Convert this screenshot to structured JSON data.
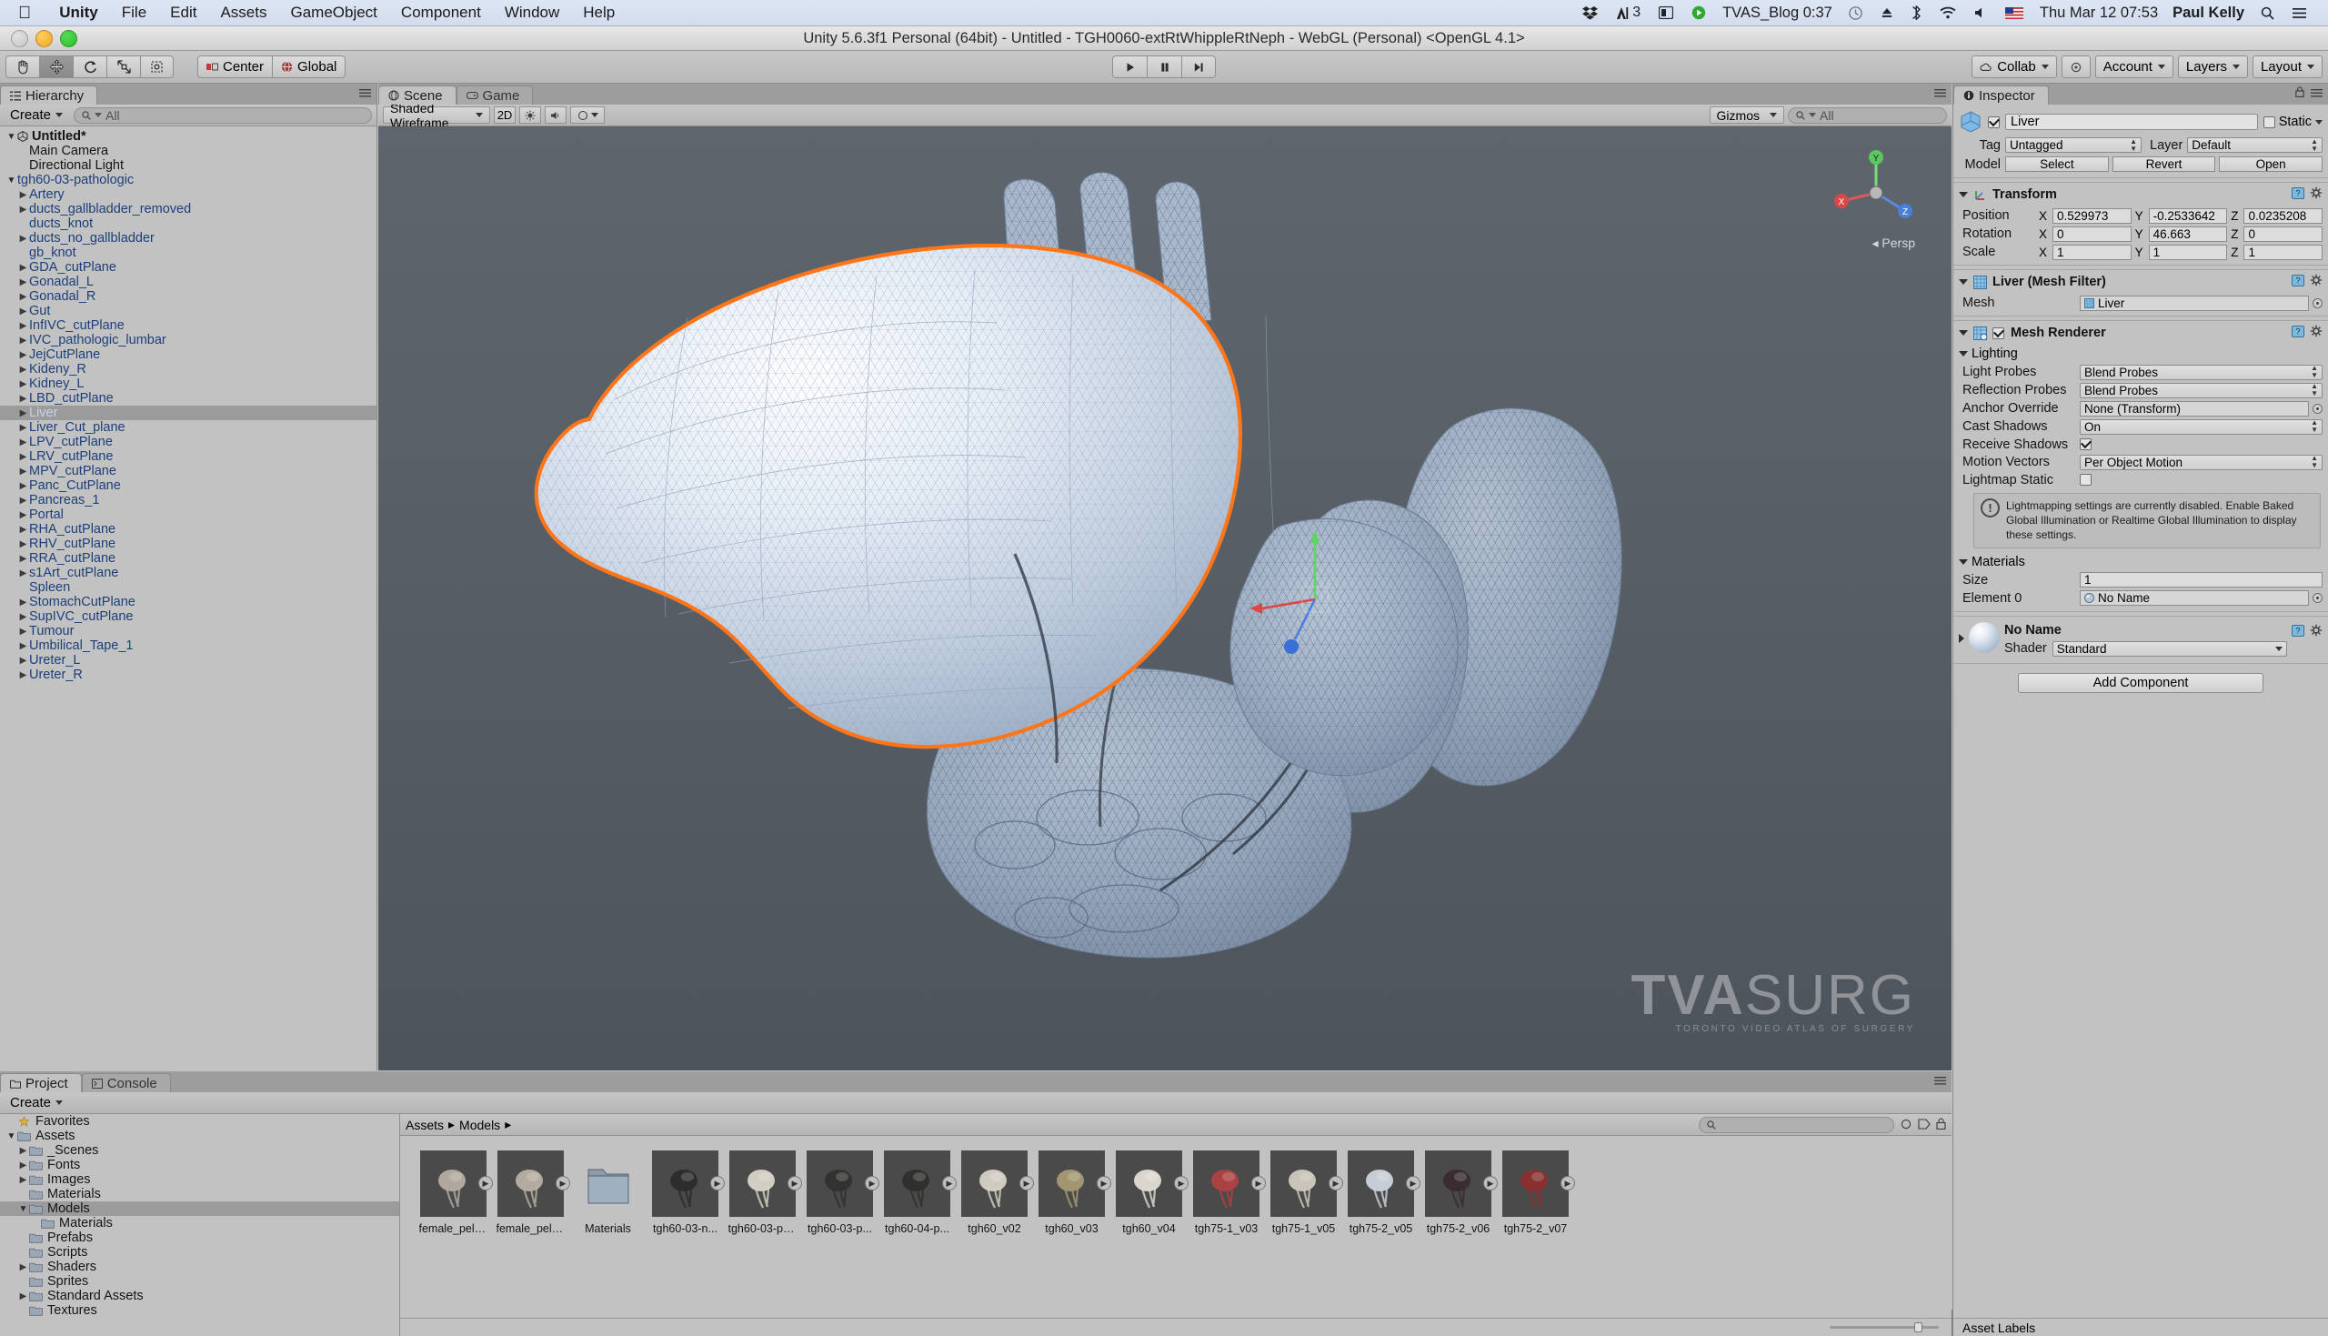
{
  "mac_menu": {
    "apple": "apple-logo",
    "items": [
      "Unity",
      "File",
      "Edit",
      "Assets",
      "GameObject",
      "Component",
      "Window",
      "Help"
    ],
    "status": {
      "adobe_count": "3",
      "recorder_label": "TVAS_Blog 0:37",
      "datetime": "Thu Mar 12  07:53",
      "user": "Paul Kelly"
    }
  },
  "window": {
    "title": "Unity 5.6.3f1 Personal (64bit) - Untitled - TGH0060-extRtWhippleRtNeph - WebGL (Personal) <OpenGL 4.1>"
  },
  "toolbar": {
    "tools": [
      "hand-tool",
      "move-tool",
      "rotate-tool",
      "scale-tool",
      "rect-tool"
    ],
    "active_tool": "move-tool",
    "pivot": "Center",
    "space": "Global",
    "play": "play-button",
    "pause": "pause-button",
    "step": "step-button",
    "collab": "Collab",
    "account": "Account",
    "layers": "Layers",
    "layout": "Layout"
  },
  "hierarchy": {
    "tab": "Hierarchy",
    "create": "Create",
    "search_placeholder": "All",
    "root": "Untitled*",
    "items": [
      {
        "label": "Main Camera",
        "indent": 1,
        "arrow": false,
        "prefab": false
      },
      {
        "label": "Directional Light",
        "indent": 1,
        "arrow": false,
        "prefab": false
      },
      {
        "label": "tgh60-03-pathologic",
        "indent": 0,
        "arrow": true,
        "open": true,
        "prefab": true
      },
      {
        "label": "Artery",
        "indent": 1,
        "arrow": true,
        "prefab": true
      },
      {
        "label": "ducts_gallbladder_removed",
        "indent": 1,
        "arrow": true,
        "prefab": true
      },
      {
        "label": "ducts_knot",
        "indent": 1,
        "arrow": false,
        "prefab": true
      },
      {
        "label": "ducts_no_gallbladder",
        "indent": 1,
        "arrow": true,
        "prefab": true
      },
      {
        "label": "gb_knot",
        "indent": 1,
        "arrow": false,
        "prefab": true
      },
      {
        "label": "GDA_cutPlane",
        "indent": 1,
        "arrow": true,
        "prefab": true
      },
      {
        "label": "Gonadal_L",
        "indent": 1,
        "arrow": true,
        "prefab": true
      },
      {
        "label": "Gonadal_R",
        "indent": 1,
        "arrow": true,
        "prefab": true
      },
      {
        "label": "Gut",
        "indent": 1,
        "arrow": true,
        "prefab": true
      },
      {
        "label": "InfIVC_cutPlane",
        "indent": 1,
        "arrow": true,
        "prefab": true
      },
      {
        "label": "IVC_pathologic_lumbar",
        "indent": 1,
        "arrow": true,
        "prefab": true
      },
      {
        "label": "JejCutPlane",
        "indent": 1,
        "arrow": true,
        "prefab": true
      },
      {
        "label": "Kideny_R",
        "indent": 1,
        "arrow": true,
        "prefab": true
      },
      {
        "label": "Kidney_L",
        "indent": 1,
        "arrow": true,
        "prefab": true
      },
      {
        "label": "LBD_cutPlane",
        "indent": 1,
        "arrow": true,
        "prefab": true
      },
      {
        "label": "Liver",
        "indent": 1,
        "arrow": true,
        "prefab": true,
        "selected": true
      },
      {
        "label": "Liver_Cut_plane",
        "indent": 1,
        "arrow": true,
        "prefab": true
      },
      {
        "label": "LPV_cutPlane",
        "indent": 1,
        "arrow": true,
        "prefab": true
      },
      {
        "label": "LRV_cutPlane",
        "indent": 1,
        "arrow": true,
        "prefab": true
      },
      {
        "label": "MPV_cutPlane",
        "indent": 1,
        "arrow": true,
        "prefab": true
      },
      {
        "label": "Panc_CutPlane",
        "indent": 1,
        "arrow": true,
        "prefab": true
      },
      {
        "label": "Pancreas_1",
        "indent": 1,
        "arrow": true,
        "prefab": true
      },
      {
        "label": "Portal",
        "indent": 1,
        "arrow": true,
        "prefab": true
      },
      {
        "label": "RHA_cutPlane",
        "indent": 1,
        "arrow": true,
        "prefab": true
      },
      {
        "label": "RHV_cutPlane",
        "indent": 1,
        "arrow": true,
        "prefab": true
      },
      {
        "label": "RRA_cutPlane",
        "indent": 1,
        "arrow": true,
        "prefab": true
      },
      {
        "label": "s1Art_cutPlane",
        "indent": 1,
        "arrow": true,
        "prefab": true
      },
      {
        "label": "Spleen",
        "indent": 1,
        "arrow": false,
        "prefab": true
      },
      {
        "label": "StomachCutPlane",
        "indent": 1,
        "arrow": true,
        "prefab": true
      },
      {
        "label": "SupIVC_cutPlane",
        "indent": 1,
        "arrow": true,
        "prefab": true
      },
      {
        "label": "Tumour",
        "indent": 1,
        "arrow": true,
        "prefab": true
      },
      {
        "label": "Umbilical_Tape_1",
        "indent": 1,
        "arrow": true,
        "prefab": true
      },
      {
        "label": "Ureter_L",
        "indent": 1,
        "arrow": true,
        "prefab": true
      },
      {
        "label": "Ureter_R",
        "indent": 1,
        "arrow": true,
        "prefab": true
      }
    ]
  },
  "scene": {
    "tab": "Scene",
    "game_tab": "Game",
    "shading_mode": "Shaded Wireframe",
    "view_2d": "2D",
    "gizmos": "Gizmos",
    "gizmo_search_placeholder": "All",
    "persp_label": "Persp",
    "axis_x": "X",
    "axis_y": "Y",
    "axis_z": "Z",
    "watermark_a": "TVA",
    "watermark_b": "SURG",
    "watermark_sub": "TORONTO VIDEO ATLAS OF SURGERY"
  },
  "project": {
    "tab": "Project",
    "console_tab": "Console",
    "create": "Create",
    "breadcrumbs": [
      "Assets",
      "Models"
    ],
    "search_placeholder": "",
    "tree": [
      {
        "label": "Favorites",
        "indent": 0,
        "star": true
      },
      {
        "label": "Assets",
        "indent": 0,
        "arrow": true,
        "open": true
      },
      {
        "label": "_Scenes",
        "indent": 1,
        "arrow": true
      },
      {
        "label": "Fonts",
        "indent": 1,
        "arrow": true
      },
      {
        "label": "Images",
        "indent": 1,
        "arrow": true
      },
      {
        "label": "Materials",
        "indent": 1
      },
      {
        "label": "Models",
        "indent": 1,
        "arrow": true,
        "open": true,
        "selected": true
      },
      {
        "label": "Materials",
        "indent": 2
      },
      {
        "label": "Prefabs",
        "indent": 1
      },
      {
        "label": "Scripts",
        "indent": 1
      },
      {
        "label": "Shaders",
        "indent": 1,
        "arrow": true
      },
      {
        "label": "Sprites",
        "indent": 1
      },
      {
        "label": "Standard Assets",
        "indent": 1,
        "arrow": true
      },
      {
        "label": "Textures",
        "indent": 1
      }
    ],
    "assets": [
      {
        "name": "female_pelvi...",
        "type": "model",
        "tint": "#b5ada0"
      },
      {
        "name": "female_pelvi...",
        "type": "model",
        "tint": "#b8b0a2"
      },
      {
        "name": "Materials",
        "type": "folder"
      },
      {
        "name": "tgh60-03-n...",
        "type": "model",
        "tint": "#2b2b2b"
      },
      {
        "name": "tgh60-03-pa...",
        "type": "model",
        "tint": "#d8d4c8"
      },
      {
        "name": "tgh60-03-p...",
        "type": "model",
        "tint": "#30302e"
      },
      {
        "name": "tgh60-04-p...",
        "type": "model",
        "tint": "#2e2e2c"
      },
      {
        "name": "tgh60_v02",
        "type": "model",
        "tint": "#d6d2c6"
      },
      {
        "name": "tgh60_v03",
        "type": "model",
        "tint": "#a59a72"
      },
      {
        "name": "tgh60_v04",
        "type": "model",
        "tint": "#e0ded4"
      },
      {
        "name": "tgh75-1_v03",
        "type": "model",
        "tint": "#b04040"
      },
      {
        "name": "tgh75-1_v05",
        "type": "model",
        "tint": "#cfcac0"
      },
      {
        "name": "tgh75-2_v05",
        "type": "model",
        "tint": "#cdd4de"
      },
      {
        "name": "tgh75-2_v06",
        "type": "model",
        "tint": "#3a2a30"
      },
      {
        "name": "tgh75-2_v07",
        "type": "model",
        "tint": "#8c2e2e"
      }
    ]
  },
  "inspector": {
    "tab": "Inspector",
    "object_name": "Liver",
    "enabled": true,
    "static_label": "Static",
    "tag_label": "Tag",
    "tag_value": "Untagged",
    "layer_label": "Layer",
    "layer_value": "Default",
    "model_label": "Model",
    "model_buttons": [
      "Select",
      "Revert",
      "Open"
    ],
    "transform": {
      "title": "Transform",
      "rows": [
        {
          "label": "Position",
          "x": "0.529973",
          "y": "-0.2533642",
          "z": "0.0235208"
        },
        {
          "label": "Rotation",
          "x": "0",
          "y": "46.663",
          "z": "0"
        },
        {
          "label": "Scale",
          "x": "1",
          "y": "1",
          "z": "1"
        }
      ],
      "axis_labels": [
        "X",
        "Y",
        "Z"
      ]
    },
    "mesh_filter": {
      "title": "Liver (Mesh Filter)",
      "mesh_label": "Mesh",
      "mesh_value": "Liver"
    },
    "mesh_renderer": {
      "title": "Mesh Renderer",
      "enabled": true,
      "lighting_label": "Lighting",
      "fields": [
        {
          "label": "Light Probes",
          "value": "Blend Probes",
          "kind": "dropdown"
        },
        {
          "label": "Reflection Probes",
          "value": "Blend Probes",
          "kind": "dropdown"
        },
        {
          "label": "Anchor Override",
          "value": "None (Transform)",
          "kind": "object"
        },
        {
          "label": "Cast Shadows",
          "value": "On",
          "kind": "dropdown"
        },
        {
          "label": "Receive Shadows",
          "value": true,
          "kind": "checkbox"
        },
        {
          "label": "Motion Vectors",
          "value": "Per Object Motion",
          "kind": "dropdown"
        },
        {
          "label": "Lightmap Static",
          "value": false,
          "kind": "checkbox"
        }
      ],
      "helpbox": "Lightmapping settings are currently disabled. Enable Baked Global Illumination or Realtime Global Illumination to display these settings.",
      "materials_label": "Materials",
      "size_label": "Size",
      "size_value": "1",
      "element_label": "Element 0",
      "element_value": "No Name"
    },
    "material": {
      "name": "No Name",
      "shader_label": "Shader",
      "shader_value": "Standard"
    },
    "add_component": "Add Component",
    "asset_labels": "Asset Labels"
  },
  "colors": {
    "selection_outline": "#ff7518",
    "hierarchy_prefab": "#1c3f7a",
    "panel_bg": "#c2c2c2",
    "scene_bg": "#5b616a"
  }
}
